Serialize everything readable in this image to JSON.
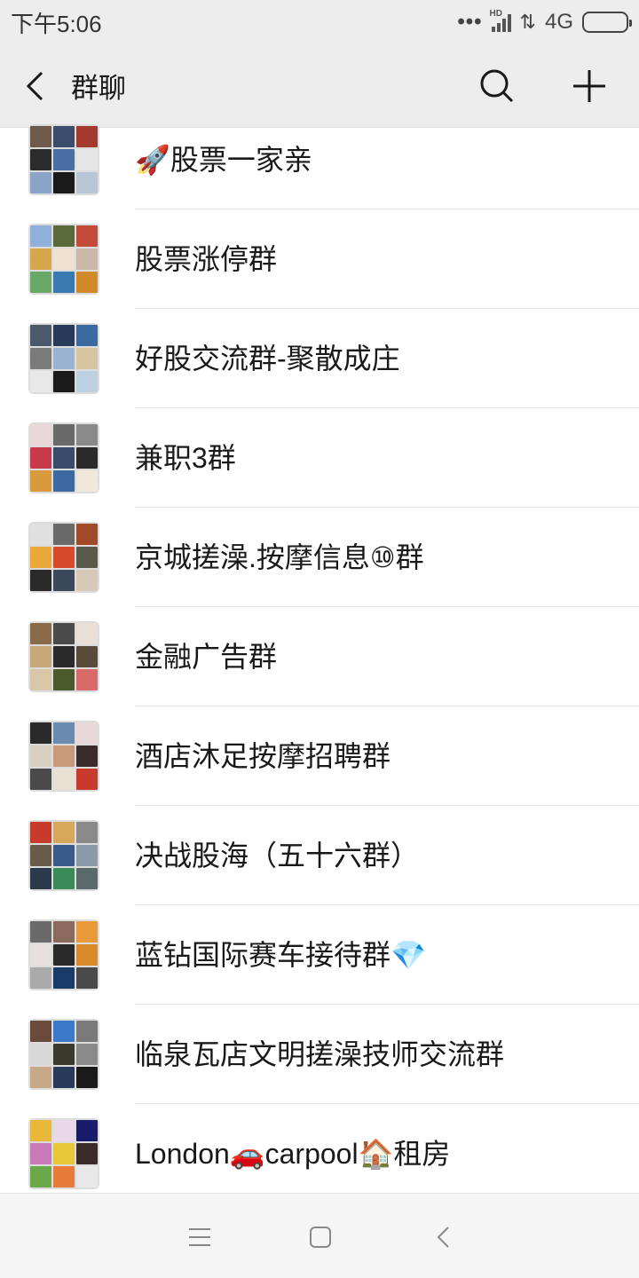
{
  "status_bar": {
    "time": "下午5:06",
    "network": "4G",
    "hd_label": "HD"
  },
  "header": {
    "title": "群聊"
  },
  "groups": [
    {
      "name": "🚀股票一家亲",
      "colors": [
        "#6d5a4a",
        "#3b4d6a",
        "#a43a2e",
        "#2c2c2c",
        "#4a6fa5",
        "#e6e6e6",
        "#8aa4c8",
        "#1a1a1a",
        "#b9c6d6"
      ]
    },
    {
      "name": "股票涨停群",
      "colors": [
        "#8fb0d8",
        "#5a6a3a",
        "#c44a3a",
        "#d6a64a",
        "#f0e0d0",
        "#c9b8a8",
        "#6aa86a",
        "#3a7ab0",
        "#d08a2a"
      ]
    },
    {
      "name": "好股交流群-聚散成庄",
      "colors": [
        "#4a5a6a",
        "#2a3a5a",
        "#3a6aa0",
        "#7a7a7a",
        "#9ab4d0",
        "#d6c6a0",
        "#e8e8e8",
        "#1a1a1a",
        "#bcd0e0"
      ]
    },
    {
      "name": "兼职3群",
      "colors": [
        "#e8d8d8",
        "#6a6a6a",
        "#8a8a8a",
        "#c83a4a",
        "#3a4a6a",
        "#2a2a2a",
        "#d89a3a",
        "#3a6aa0",
        "#f0e8d8"
      ]
    },
    {
      "name": "京城搓澡.按摩信息⑩群",
      "colors": [
        "#e0e0e0",
        "#6a6a6a",
        "#a04a2a",
        "#e8a83a",
        "#d84a2a",
        "#5a5a4a",
        "#2a2a2a",
        "#3a4a5a",
        "#d8c8b8"
      ]
    },
    {
      "name": "金融广告群",
      "colors": [
        "#8a6a4a",
        "#4a4a4a",
        "#e8e0d8",
        "#c8a878",
        "#2a2a2a",
        "#5a4a3a",
        "#d8c8a8",
        "#4a5a2a",
        "#d86a6a"
      ]
    },
    {
      "name": "酒店沐足按摩招聘群",
      "colors": [
        "#2a2a2a",
        "#6a8ab0",
        "#e8d8d8",
        "#d8d0c0",
        "#c89a7a",
        "#3a2a2a",
        "#4a4a4a",
        "#e8e0d0",
        "#c83a2a"
      ]
    },
    {
      "name": "决战股海（五十六群）",
      "colors": [
        "#c83a2a",
        "#d8a85a",
        "#8a8a8a",
        "#6a5a4a",
        "#3a5a8a",
        "#8a9aaa",
        "#2a3a4a",
        "#3a8a5a",
        "#5a6a6a"
      ]
    },
    {
      "name": "蓝钻国际赛车接待群💎",
      "colors": [
        "#6a6a6a",
        "#8a6a5a",
        "#e89a3a",
        "#e8e0e0",
        "#2a2a2a",
        "#d88a2a",
        "#aaaaaa",
        "#1a3a6a",
        "#4a4a4a"
      ]
    },
    {
      "name": "临泉瓦店文明搓澡技师交流群",
      "colors": [
        "#6a4a3a",
        "#3a7ac8",
        "#7a7a7a",
        "#d8d8d8",
        "#3a3a2a",
        "#8a8a8a",
        "#c8a888",
        "#2a3a5a",
        "#1a1a1a"
      ]
    },
    {
      "name": "London🚗carpool🏠租房",
      "colors": [
        "#e8b83a",
        "#e8d8e8",
        "#1a1a6a",
        "#c87ab8",
        "#e8c83a",
        "#3a2a2a",
        "#6aa84a",
        "#e87a3a",
        "#e8e8e8"
      ]
    }
  ]
}
